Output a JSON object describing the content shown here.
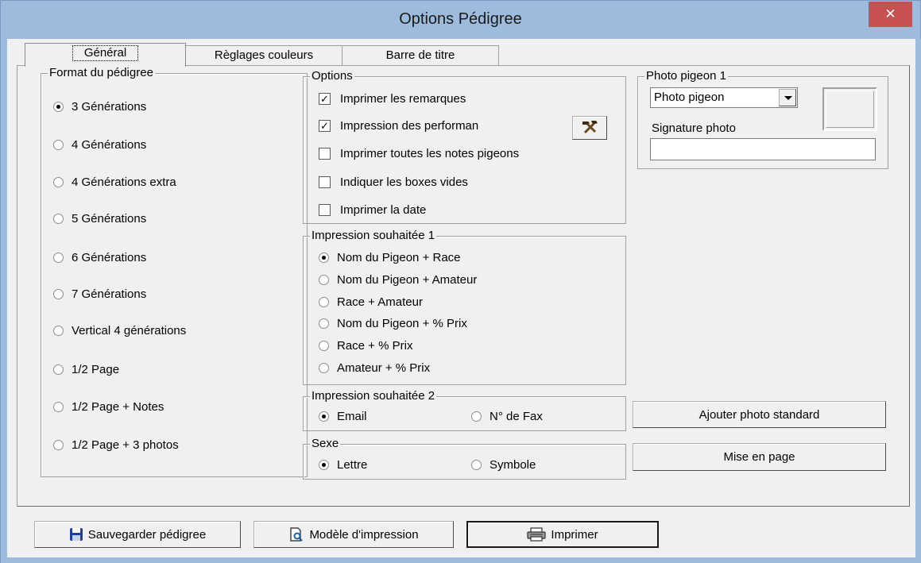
{
  "window": {
    "title": "Options Pédigree",
    "close": "✕"
  },
  "tabs": [
    "Général",
    "Règlages couleurs",
    "Barre de titre"
  ],
  "format": {
    "legend": "Format du pédigree",
    "options": [
      "3 Générations",
      "4 Générations",
      "4 Générations extra",
      "5 Générations",
      "6 Générations",
      "7 Générations",
      "Vertical 4 générations",
      "1/2 Page",
      "1/2 Page + Notes",
      "1/2 Page + 3 photos"
    ],
    "selected": "3 Générations"
  },
  "options": {
    "legend": "Options",
    "items": [
      {
        "label": "Imprimer les remarques",
        "checked": true
      },
      {
        "label": "Impression des performan",
        "checked": true
      },
      {
        "label": "Imprimer toutes les notes pigeons",
        "checked": false
      },
      {
        "label": "Indiquer les boxes vides",
        "checked": false
      },
      {
        "label": "Imprimer la date",
        "checked": false
      }
    ],
    "tool_icon": "hammer-icon"
  },
  "impression1": {
    "legend": "Impression souhaitée 1",
    "options": [
      "Nom du Pigeon + Race",
      "Nom du Pigeon + Amateur",
      "Race + Amateur",
      "Nom du Pigeon + % Prix",
      "Race + % Prix",
      "Amateur + % Prix"
    ],
    "selected": "Nom du Pigeon + Race"
  },
  "impression2": {
    "legend": "Impression souhaitée 2",
    "options": [
      "Email",
      "N° de Fax"
    ],
    "selected": "Email"
  },
  "sexe": {
    "legend": "Sexe",
    "options": [
      "Lettre",
      "Symbole"
    ],
    "selected": "Lettre"
  },
  "photo": {
    "legend": "Photo pigeon 1",
    "combo_value": "Photo pigeon",
    "signature_label": "Signature photo",
    "signature_value": ""
  },
  "side_buttons": {
    "standard_photo": "Ajouter photo standard",
    "layout": "Mise en page"
  },
  "bottom_buttons": {
    "save": "Sauvegarder pédigree",
    "template": "Modèle d'impression",
    "print": "Imprimer"
  },
  "colors": {
    "frame": "#9dbbdd",
    "close": "#c75050",
    "face": "#f0f0f0",
    "save_icon": "#1f3f9f"
  }
}
